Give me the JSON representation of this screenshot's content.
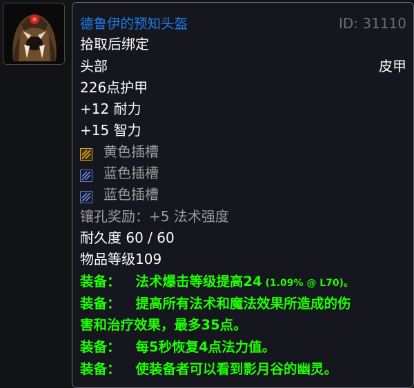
{
  "item_icon": {
    "name": "druid-helm-icon"
  },
  "tooltip": {
    "name": "德鲁伊的预知头盔",
    "id_text": "ID: 31110",
    "bind": "拾取后绑定",
    "slot": "头部",
    "armor_type": "皮甲",
    "armor": "226点护甲",
    "stats": [
      "+12 耐力",
      "+15 智力"
    ],
    "sockets": [
      {
        "label": "黄色插槽",
        "icon": "yellow-socket-icon"
      },
      {
        "label": "蓝色插槽",
        "icon": "blue-socket-icon"
      },
      {
        "label": "蓝色插槽",
        "icon": "blue-socket-icon"
      }
    ],
    "socket_bonus": "镶孔奖励：+5 法术强度",
    "durability": "耐久度 60 / 60",
    "item_level": "物品等级109",
    "equip_prefix": "装备：",
    "equips": [
      {
        "main": "法术爆击等级提高24",
        "detail": " (1.09% @ L70)。"
      },
      {
        "main": "提高所有法术和魔法效果所造成的伤",
        "cont": "害和治疗效果，最多35点。"
      },
      {
        "main": "每5秒恢复4点法力值。"
      },
      {
        "main": "使装备者可以看到影月谷的幽灵。"
      }
    ],
    "colors": {
      "name": "#1e7eea",
      "equip": "#1eff00",
      "grey": "#9d9d9d",
      "id": "#6d6d78"
    }
  }
}
